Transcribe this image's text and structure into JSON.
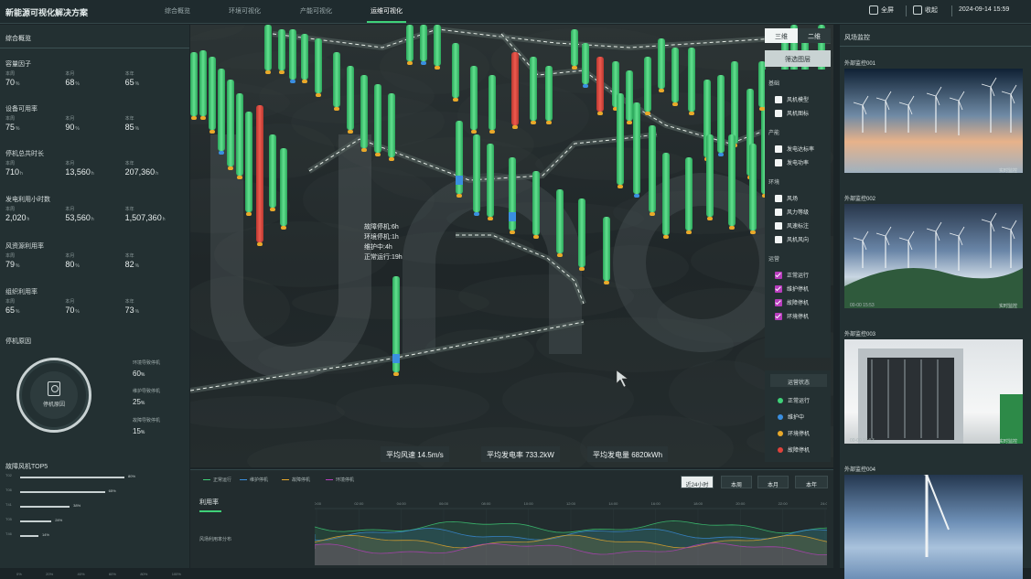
{
  "app": {
    "title": "新能源可视化解决方案"
  },
  "nav": {
    "tabs": [
      {
        "label": "综合概览",
        "active": false
      },
      {
        "label": "环境可视化",
        "active": false
      },
      {
        "label": "产能可视化",
        "active": false
      },
      {
        "label": "运维可视化",
        "active": true
      }
    ]
  },
  "topbar": {
    "fullscreen": "全屏",
    "collapse": "收起",
    "date": "2024-09-14 15:59"
  },
  "left": {
    "header": "综合概览",
    "metrics": [
      {
        "title": "容量因子",
        "values": [
          {
            "sub": "本周",
            "val": "70",
            "unit": "%"
          },
          {
            "sub": "本月",
            "val": "68",
            "unit": "%"
          },
          {
            "sub": "本年",
            "val": "65",
            "unit": "%"
          }
        ]
      },
      {
        "title": "设备可用率",
        "values": [
          {
            "sub": "本周",
            "val": "75",
            "unit": "%"
          },
          {
            "sub": "本月",
            "val": "90",
            "unit": "%"
          },
          {
            "sub": "本年",
            "val": "85",
            "unit": "%"
          }
        ]
      },
      {
        "title": "停机总共时长",
        "values": [
          {
            "sub": "本周",
            "val": "710",
            "unit": "h"
          },
          {
            "sub": "本月",
            "val": "13,560",
            "unit": "h"
          },
          {
            "sub": "本年",
            "val": "207,360",
            "unit": "h"
          }
        ]
      },
      {
        "title": "发电利用小时数",
        "values": [
          {
            "sub": "本周",
            "val": "2,020",
            "unit": "h"
          },
          {
            "sub": "本月",
            "val": "53,560",
            "unit": "h"
          },
          {
            "sub": "本年",
            "val": "1,507,360",
            "unit": "h"
          }
        ]
      },
      {
        "title": "风资源利用率",
        "values": [
          {
            "sub": "本周",
            "val": "79",
            "unit": "%"
          },
          {
            "sub": "本月",
            "val": "80",
            "unit": "%"
          },
          {
            "sub": "本年",
            "val": "82",
            "unit": "%"
          }
        ]
      },
      {
        "title": "组织利用率",
        "values": [
          {
            "sub": "本周",
            "val": "65",
            "unit": "%"
          },
          {
            "sub": "本月",
            "val": "70",
            "unit": "%"
          },
          {
            "sub": "本年",
            "val": "73",
            "unit": "%"
          }
        ]
      }
    ],
    "stop_title": "停机原因",
    "stop_center": "停机原因",
    "stop_items": [
      {
        "label": "环境导致停机",
        "value": "60",
        "unit": "%"
      },
      {
        "label": "维护导致停机",
        "value": "25",
        "unit": "%"
      },
      {
        "label": "故障导致停机",
        "value": "15",
        "unit": "%"
      }
    ],
    "top5_title": "故障风机TOP5",
    "top5": [
      {
        "id": "T02",
        "pct": 80,
        "label": "80%"
      },
      {
        "id": "T06",
        "pct": 65,
        "label": "65%"
      },
      {
        "id": "T41",
        "pct": 38,
        "label": "38%"
      },
      {
        "id": "T05",
        "pct": 24,
        "label": "24%"
      },
      {
        "id": "T46",
        "pct": 14,
        "label": "14%"
      }
    ],
    "top5_axis": [
      "0%",
      "20%",
      "40%",
      "60%",
      "80%",
      "100%"
    ]
  },
  "map": {
    "popup": [
      "故障停机:6h",
      "环境停机:1h",
      "维护中:4h",
      "正常运行:19h"
    ],
    "stats": [
      {
        "label": "平均风速",
        "value": "14.5m/s"
      },
      {
        "label": "平均发电率",
        "value": "733.2kW"
      },
      {
        "label": "平均发电量",
        "value": "6820kWh"
      }
    ],
    "view": {
      "three_d": "三维",
      "two_d": "二维"
    },
    "filter_button": "筛选图层",
    "filters": [
      {
        "group": "基础",
        "items": [
          {
            "label": "风机模型",
            "checked": false
          },
          {
            "label": "风机图标",
            "checked": false
          }
        ]
      },
      {
        "group": "产能",
        "items": [
          {
            "label": "发电达标率",
            "checked": false
          },
          {
            "label": "发电功率",
            "checked": false
          }
        ]
      },
      {
        "group": "环境",
        "items": [
          {
            "label": "风场",
            "checked": false
          },
          {
            "label": "风力等级",
            "checked": false
          },
          {
            "label": "风速标注",
            "checked": false
          },
          {
            "label": "风机风向",
            "checked": false
          }
        ]
      },
      {
        "group": "运营",
        "items": [
          {
            "label": "正常运行",
            "checked": true
          },
          {
            "label": "维护停机",
            "checked": true
          },
          {
            "label": "故障停机",
            "checked": true
          },
          {
            "label": "环境停机",
            "checked": true
          }
        ]
      }
    ],
    "legend_title": "运营状态",
    "legend": [
      {
        "label": "正常运行",
        "color": "#3fd178"
      },
      {
        "label": "维护中",
        "color": "#3a8fe0"
      },
      {
        "label": "环境停机",
        "color": "#e9a92a"
      },
      {
        "label": "故障停机",
        "color": "#e0423b"
      }
    ]
  },
  "bottom": {
    "legend": [
      {
        "label": "正常运行",
        "color": "#3fd178"
      },
      {
        "label": "维护停机",
        "color": "#3a8fe0"
      },
      {
        "label": "故障停机",
        "color": "#e9a92a"
      },
      {
        "label": "环境停机",
        "color": "#b83dbd"
      }
    ],
    "ranges": [
      {
        "label": "近24小时",
        "active": true
      },
      {
        "label": "本周",
        "active": false
      },
      {
        "label": "本月",
        "active": false
      },
      {
        "label": "本年",
        "active": false
      }
    ],
    "tab": "利用率",
    "row_label": "风场利用率分布",
    "hours": [
      "00:00",
      "02:00",
      "04:00",
      "06:00",
      "08:00",
      "10:00",
      "12:00",
      "14:00",
      "16:00",
      "18:00",
      "20:00",
      "22:00",
      "24:00"
    ]
  },
  "right": {
    "header": "风场监控",
    "cams": [
      {
        "title": "外部监控001",
        "time": "00-00 15:53",
        "live": "实时监控"
      },
      {
        "title": "外部监控002",
        "time": "00-00 15:53",
        "live": "实时监控"
      },
      {
        "title": "外部监控003",
        "time": "00-00 15:53",
        "live": "实时监控"
      },
      {
        "title": "外部监控004",
        "time": "",
        "live": ""
      }
    ]
  }
}
